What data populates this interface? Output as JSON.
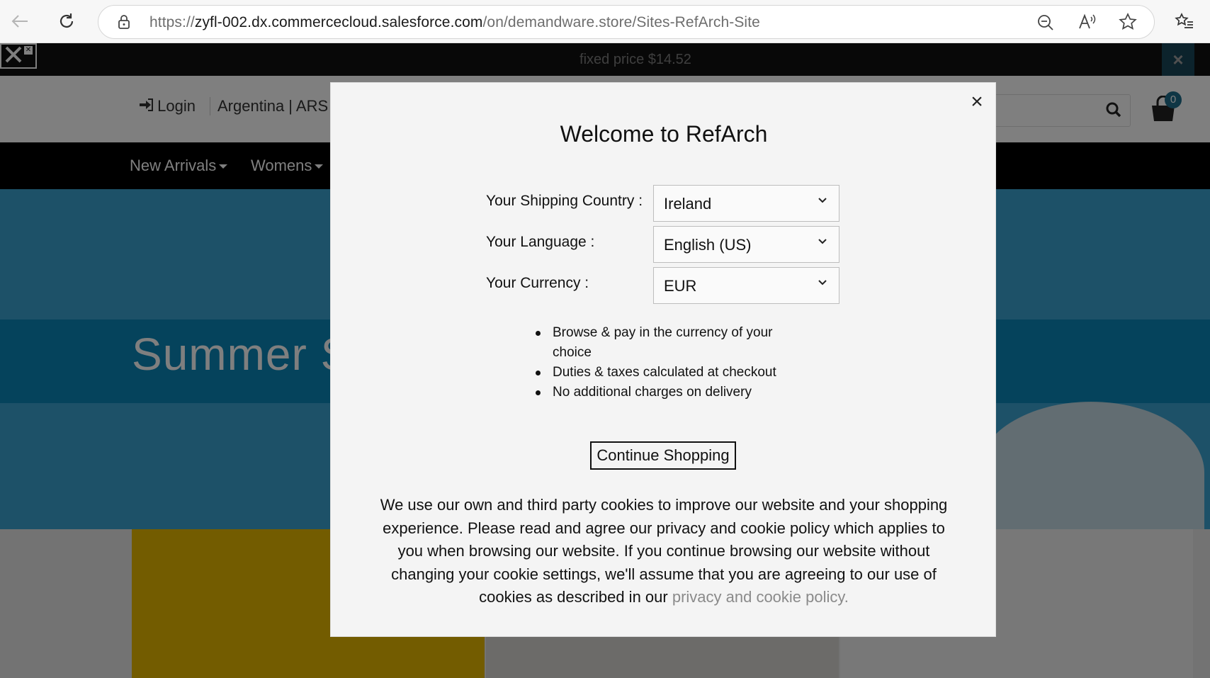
{
  "browser": {
    "url_prefix": "https://",
    "url_host": "zyfl-002.dx.commercecloud.salesforce.com",
    "url_path": "/on/demandware.store/Sites-RefArch-Site"
  },
  "promo": {
    "text": "fixed price $14.52",
    "close": "×"
  },
  "header": {
    "login": "Login",
    "country": "Argentina | ARS",
    "cart_count": "0"
  },
  "nav": {
    "items": [
      {
        "label": "New Arrivals"
      },
      {
        "label": "Womens"
      }
    ]
  },
  "hero": {
    "title": "Summer St"
  },
  "modal": {
    "title": "Welcome to RefArch",
    "close": "×",
    "fields": [
      {
        "label": "Your Shipping Country :",
        "value": "Ireland"
      },
      {
        "label": "Your Language :",
        "value": "English (US)"
      },
      {
        "label": "Your Currency :",
        "value": "EUR"
      }
    ],
    "benefits": [
      "Browse & pay in the currency of your choice",
      "Duties & taxes calculated at checkout",
      "No additional charges on delivery"
    ],
    "continue_label": "Continue Shopping",
    "cookie_text": "We use our own and third party cookies to improve our website and your shopping experience. Please read and agree our privacy and cookie policy which applies to you when browsing our website. If you continue browsing our website without changing your cookie settings, we'll assume that you are agreeing to our use of cookies as described in our ",
    "cookie_link": "privacy and cookie policy."
  },
  "colors": {
    "hero_blue": "#3ba2d0",
    "hero_band": "#0a86b8",
    "accent": "#1f6c8a"
  }
}
